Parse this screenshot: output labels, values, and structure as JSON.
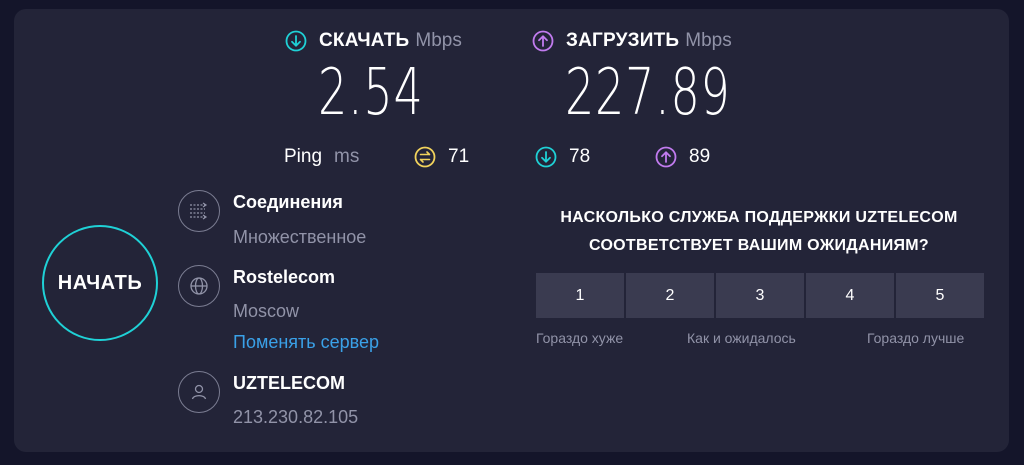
{
  "download": {
    "label": "СКАЧАТЬ",
    "unit": "Mbps",
    "value": "2.54",
    "color": "#1fd1d6"
  },
  "upload": {
    "label": "ЗАГРУЗИТЬ",
    "unit": "Mbps",
    "value": "227.89",
    "color": "#c17bef"
  },
  "ping": {
    "label": "Ping",
    "unit": "ms",
    "idle": "71",
    "download": "78",
    "upload": "89",
    "idle_color": "#f2d35c"
  },
  "start_button": "НАЧАТЬ",
  "connection": {
    "title": "Соединения",
    "value": "Множественное"
  },
  "server": {
    "name": "Rostelecom",
    "location": "Moscow",
    "change_link": "Поменять сервер"
  },
  "provider": {
    "name": "UZTELECOM",
    "ip": "213.230.82.105"
  },
  "survey": {
    "question_line1": "НАСКОЛЬКО СЛУЖБА ПОДДЕРЖКИ UZTELECOM",
    "question_line2": "СООТВЕТСТВУЕТ ВАШИМ ОЖИДАНИЯМ?",
    "options": [
      "1",
      "2",
      "3",
      "4",
      "5"
    ],
    "scale_low": "Гораздо хуже",
    "scale_mid": "Как и ожидалось",
    "scale_high": "Гораздо лучше"
  }
}
